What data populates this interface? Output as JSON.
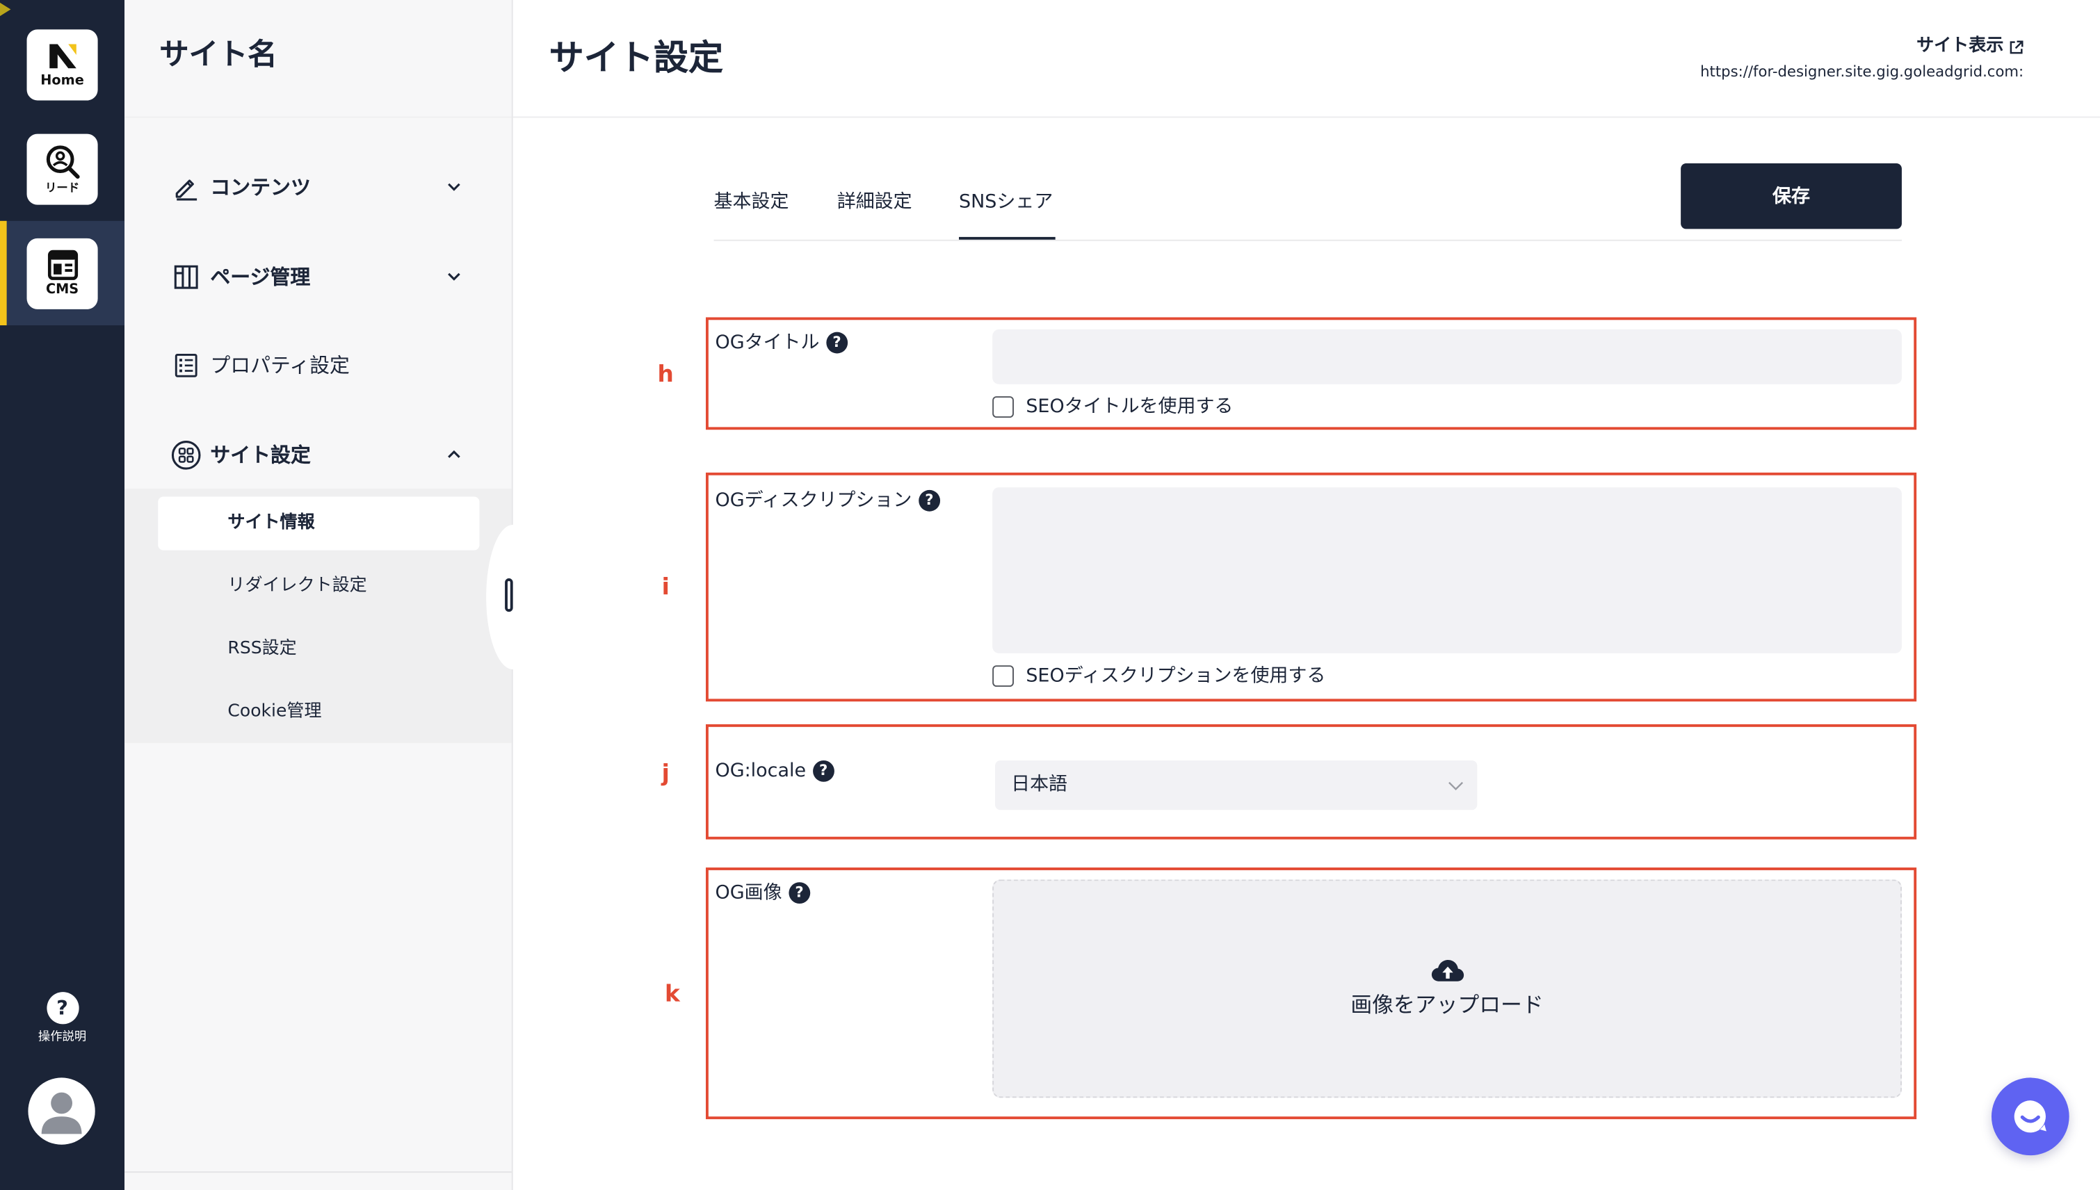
{
  "rail": {
    "home": {
      "label": "Home",
      "icon": "brand-logo-icon"
    },
    "lead": {
      "label": "リード",
      "icon": "lead-search-icon"
    },
    "cms": {
      "label": "CMS",
      "icon": "cms-layout-icon",
      "active": true
    },
    "help": {
      "label": "操作説明",
      "icon": "help-circle-icon"
    },
    "avatar": {
      "icon": "user-avatar-icon"
    }
  },
  "icons": {
    "help_glyph": "?"
  },
  "sidebar": {
    "site_name": "サイト名",
    "nav": [
      {
        "label": "コンテンツ",
        "icon": "pencil-icon",
        "chevron": "chevron-down-icon"
      },
      {
        "label": "ページ管理",
        "icon": "page-layout-icon",
        "chevron": "chevron-down-icon"
      },
      {
        "label": "プロパティ設定",
        "icon": "property-list-icon"
      },
      {
        "label": "サイト設定",
        "icon": "site-settings-icon",
        "chevron": "chevron-up-icon",
        "expanded": true
      }
    ],
    "sub_items": [
      {
        "label": "サイト情報",
        "active": true
      },
      {
        "label": "リダイレクト設定"
      },
      {
        "label": "RSS設定"
      },
      {
        "label": "Cookie管理"
      }
    ]
  },
  "header": {
    "title": "サイト設定",
    "view_site_label": "サイト表示",
    "view_site_icon": "external-link-icon",
    "site_url": "https://for-designer.site.gig.goleadgrid.com:"
  },
  "tabs": [
    {
      "label": "基本設定",
      "active": false
    },
    {
      "label": "詳細設定",
      "active": false
    },
    {
      "label": "SNSシェア",
      "active": true
    }
  ],
  "toolbar": {
    "save_label": "保存"
  },
  "form": {
    "og_title": {
      "annotation": "h",
      "label": "OGタイトル",
      "value": "",
      "seo_checkbox": {
        "label": "SEOタイトルを使用する",
        "checked": false
      }
    },
    "og_description": {
      "annotation": "i",
      "label": "OGディスクリプション",
      "value": "",
      "seo_checkbox": {
        "label": "SEOディスクリプションを使用する",
        "checked": false
      }
    },
    "og_locale": {
      "annotation": "j",
      "label": "OG:locale",
      "selected": "日本語"
    },
    "og_image": {
      "annotation": "k",
      "label": "OG画像",
      "upload_label": "画像をアップロード",
      "upload_icon": "cloud-upload-icon"
    }
  },
  "chat": {
    "icon": "chat-icon"
  },
  "colors": {
    "rail_bg": "#1b2437",
    "rail_active_bg": "#2b3853",
    "accent_yellow": "#f2c31b",
    "primary_button": "#1b2437",
    "annotation_red": "#e34a33",
    "field_bg": "#f2f2f5",
    "chat_button": "#5f63f2"
  }
}
